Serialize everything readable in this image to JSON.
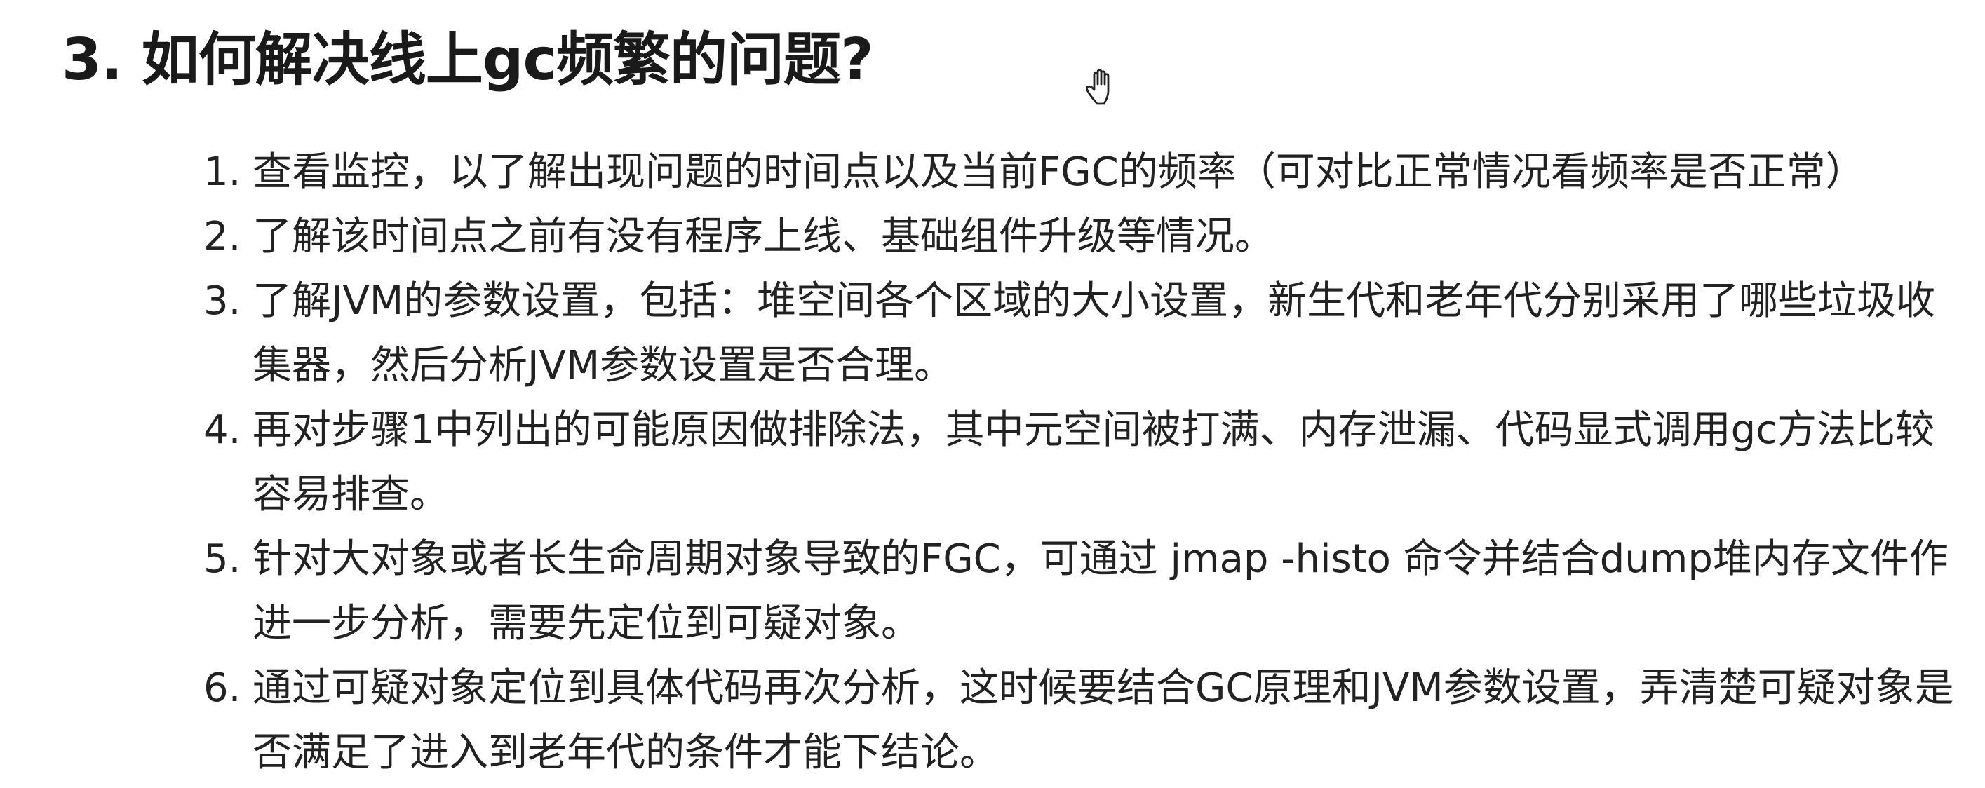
{
  "heading": "3. 如何解决线上gc频繁的问题?",
  "cursor_icon": "hand-cursor-icon",
  "steps": [
    {
      "num": "1.",
      "text": "查看监控，以了解出现问题的时间点以及当前FGC的频率（可对比正常情况看频率是否正常）"
    },
    {
      "num": "2.",
      "text": "了解该时间点之前有没有程序上线、基础组件升级等情况。"
    },
    {
      "num": "3.",
      "text": "了解JVM的参数设置，包括：堆空间各个区域的大小设置，新生代和老年代分别采用了哪些垃圾收集器，然后分析JVM参数设置是否合理。"
    },
    {
      "num": "4.",
      "text": "再对步骤1中列出的可能原因做排除法，其中元空间被打满、内存泄漏、代码显式调用gc方法比较容易排查。"
    },
    {
      "num": "5.",
      "text": "针对大对象或者长生命周期对象导致的FGC，可通过 jmap -histo 命令并结合dump堆内存文件作进一步分析，需要先定位到可疑对象。"
    },
    {
      "num": "6.",
      "text": "通过可疑对象定位到具体代码再次分析，这时候要结合GC原理和JVM参数设置，弄清楚可疑对象是否满足了进入到老年代的条件才能下结论。"
    }
  ]
}
